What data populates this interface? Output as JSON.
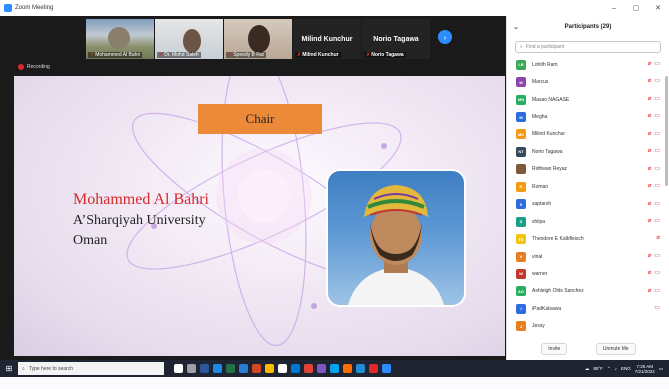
{
  "window": {
    "title": "Zoom Meeting",
    "controls": [
      "–",
      "▢",
      "✕"
    ]
  },
  "thumbnails": [
    {
      "name": "Mohammed Al Bahri",
      "kind": "video1",
      "muted": true
    },
    {
      "name": "Dr. Mohd Saleh",
      "kind": "video2",
      "muted": true
    },
    {
      "name": "Speedy B Rai",
      "kind": "video3",
      "muted": true
    },
    {
      "name": "Milind Kunchur",
      "kind": "text",
      "muted": true
    },
    {
      "name": "Norio Tagawa",
      "kind": "text",
      "muted": true
    }
  ],
  "recording_label": "Recording",
  "slide": {
    "chair_label": "Chair",
    "speaker_name": "Mohammed Al Bahri",
    "affiliation": "A’Sharqiyah University",
    "country": "Oman"
  },
  "participants_panel": {
    "title": "Participants (29)",
    "search_placeholder": "Find a participant",
    "invite_label": "Invite",
    "unmute_label": "Unmute Me",
    "items": [
      {
        "initials": "LR",
        "name": "Lohith Ram",
        "color": "#3aa757",
        "mic_off": true,
        "video_off": true
      },
      {
        "initials": "M",
        "name": "Marcus",
        "color": "#8e44ad",
        "mic_off": true,
        "video_off": true
      },
      {
        "initials": "MN",
        "name": "Masao NAGASE",
        "color": "#27ae60",
        "mic_off": true,
        "video_off": true
      },
      {
        "initials": "M",
        "name": "Megha",
        "color": "#2d6cdf",
        "mic_off": true,
        "video_off": true
      },
      {
        "initials": "MK",
        "name": "Milind Kunchur",
        "color": "#f39c12",
        "mic_off": true,
        "video_off": true
      },
      {
        "initials": "NT",
        "name": "Norio Tagawa",
        "color": "#34495e",
        "mic_off": true,
        "video_off": true
      },
      {
        "initials": "",
        "name": "Ridhwan Reyaz",
        "color": "#7f5a3a",
        "mic_off": true,
        "video_off": true
      },
      {
        "initials": "R",
        "name": "Roman",
        "color": "#f39c12",
        "mic_off": true,
        "video_off": true
      },
      {
        "initials": "S",
        "name": "saptarsh",
        "color": "#2d6cdf",
        "mic_off": true,
        "video_off": true
      },
      {
        "initials": "S",
        "name": "shilpa",
        "color": "#16a085",
        "mic_off": true,
        "video_off": true
      },
      {
        "initials": "TK",
        "name": "Theodore E Kalbfleisch",
        "color": "#f1c40f",
        "mic_off": true,
        "video_off": false
      },
      {
        "initials": "V",
        "name": "vinal",
        "color": "#e67e22",
        "mic_off": true,
        "video_off": true
      },
      {
        "initials": "W",
        "name": "warner",
        "color": "#c0392b",
        "mic_off": true,
        "video_off": true
      },
      {
        "initials": "AO",
        "name": "Ashleigh Olds Sanchez",
        "color": "#27ae60",
        "mic_off": true,
        "video_off": true
      },
      {
        "initials": "I",
        "name": "iPadKatsawa",
        "color": "#2d6cdf",
        "mic_off": false,
        "video_off": true
      },
      {
        "initials": "J",
        "name": "Jessy",
        "color": "#e67e22",
        "mic_off": false,
        "video_off": false
      }
    ]
  },
  "taskbar": {
    "search_placeholder": "Type here to search",
    "weather": "85°F",
    "language": "ENG",
    "time": "7:26 AM",
    "date": "7/21/2022",
    "app_colors": [
      "#ffffff",
      "#9aa0a6",
      "#2b579a",
      "#1e88e5",
      "#217346",
      "#2b7cd3",
      "#d24726",
      "#ffb900",
      "#ffffff",
      "#0078d4",
      "#e34133",
      "#7e57c2",
      "#00a4ef",
      "#ff6f00",
      "#1f8dd6",
      "#e02828",
      "#2d8cff"
    ]
  }
}
